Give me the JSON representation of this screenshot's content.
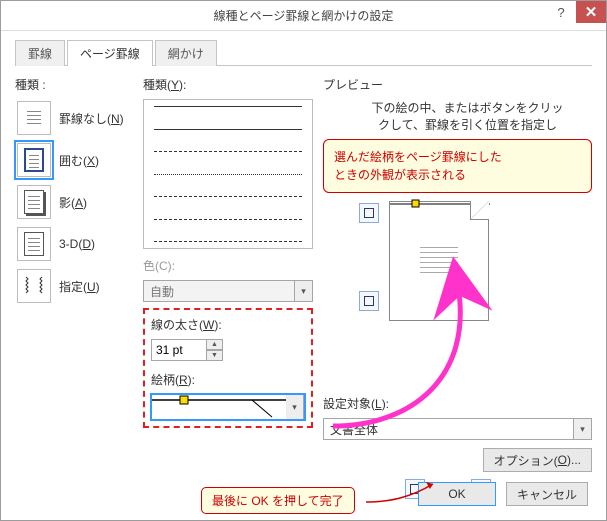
{
  "window": {
    "title": "線種とページ罫線と網かけの設定"
  },
  "tabs": {
    "t1": "罫線",
    "t2": "ページ罫線",
    "t3": "網かけ"
  },
  "col1": {
    "label": "種類 :",
    "items": {
      "none": "罫線なし(N)",
      "box": "囲む(X)",
      "shadow": "影(A)",
      "threeD": "3-D(D)",
      "custom": "指定(U)"
    }
  },
  "col2": {
    "style_label": "種類(Y):",
    "color_label": "色(C):",
    "color_value": "自動",
    "width_label": "線の太さ(W):",
    "width_value": "31 pt",
    "art_label": "絵柄(R):"
  },
  "col3": {
    "preview_label": "プレビュー",
    "preview_note1": "下の絵の中、またはボタンをクリッ",
    "preview_note2": "クして、罫線を引く位置を指定し",
    "callout_l1": "選んだ絵柄をページ罫線にした",
    "callout_l2": "ときの外観が表示される",
    "target_label": "設定対象(L):",
    "target_value": "文書全体",
    "options_btn": "オプション(O)..."
  },
  "buttons": {
    "ok": "OK",
    "cancel": "キャンセル"
  },
  "bottom_callout": "最後に OK を押して完了"
}
